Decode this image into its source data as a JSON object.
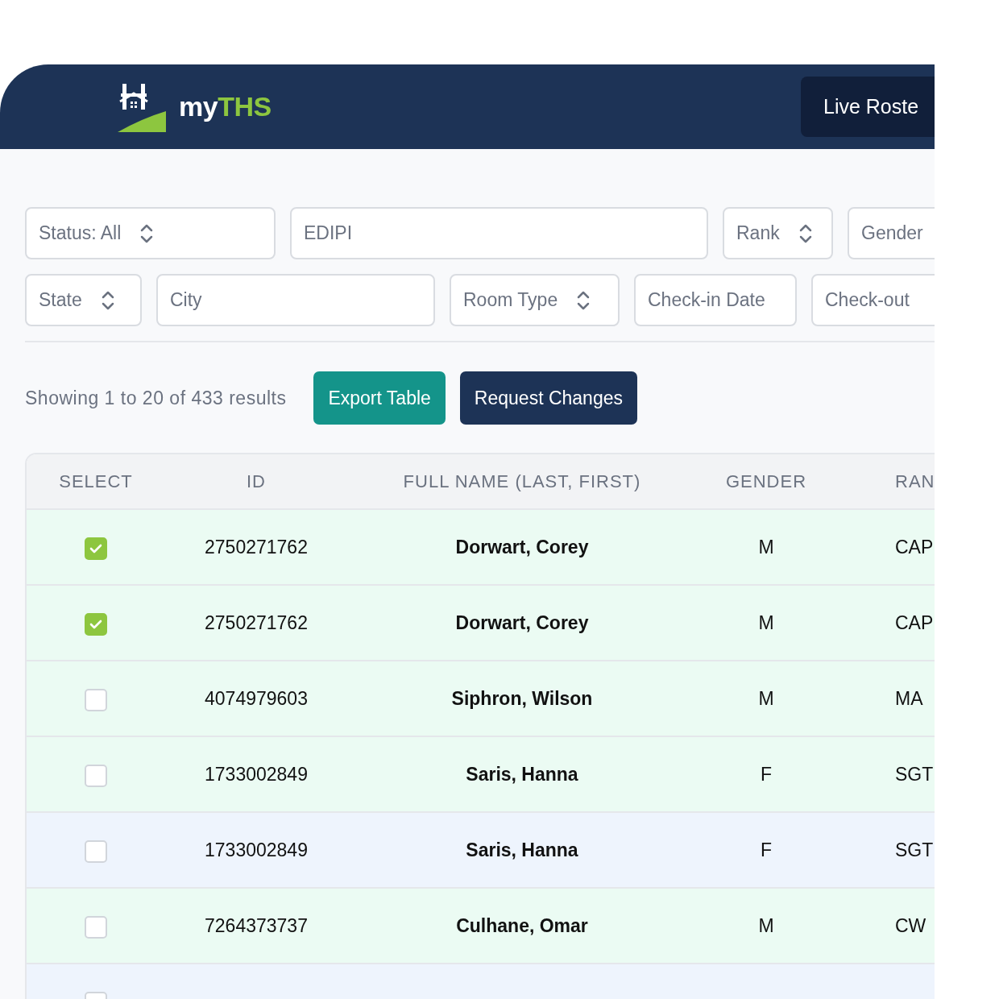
{
  "header": {
    "logo": {
      "prefix": "my",
      "suffix": "THS"
    },
    "nav_button": "Live Roste"
  },
  "filters": [
    [
      {
        "kind": "select",
        "label": "Status: All"
      },
      {
        "kind": "input",
        "placeholder": "EDIPI"
      },
      {
        "kind": "select",
        "label": "Rank"
      },
      {
        "kind": "select",
        "label": "Gender"
      }
    ],
    [
      {
        "kind": "select",
        "label": "State"
      },
      {
        "kind": "input",
        "placeholder": "City"
      },
      {
        "kind": "select",
        "label": "Room Type"
      },
      {
        "kind": "input",
        "placeholder": "Check-in Date"
      },
      {
        "kind": "input",
        "placeholder": "Check-out"
      }
    ]
  ],
  "summary": "Showing 1 to 20 of 433 results",
  "actions": [
    "Export Table",
    "Request Changes"
  ],
  "table": {
    "columns": [
      "SELECT",
      "ID",
      "FULL NAME (LAST, FIRST)",
      "GENDER",
      "RAN"
    ],
    "rows": [
      {
        "checked": true,
        "color": "#ebfbf3",
        "id": "2750271762",
        "name": "Dorwart, Corey",
        "gender": "M",
        "rank": "CAP"
      },
      {
        "checked": true,
        "color": "#ebfbf3",
        "id": "2750271762",
        "name": "Dorwart, Corey",
        "gender": "M",
        "rank": "CAP"
      },
      {
        "checked": false,
        "color": "#ebfbf3",
        "id": "4074979603",
        "name": "Siphron, Wilson",
        "gender": "M",
        "rank": "MA"
      },
      {
        "checked": false,
        "color": "#ebfbf3",
        "id": "1733002849",
        "name": "Saris, Hanna",
        "gender": "F",
        "rank": "SGT"
      },
      {
        "checked": false,
        "color": "#eef4fd",
        "id": "1733002849",
        "name": "Saris, Hanna",
        "gender": "F",
        "rank": "SGT"
      },
      {
        "checked": false,
        "color": "#ebfbf3",
        "id": "7264373737",
        "name": "Culhane, Omar",
        "gender": "M",
        "rank": "CW"
      },
      {
        "checked": false,
        "color": "#eef4fd"
      }
    ]
  }
}
